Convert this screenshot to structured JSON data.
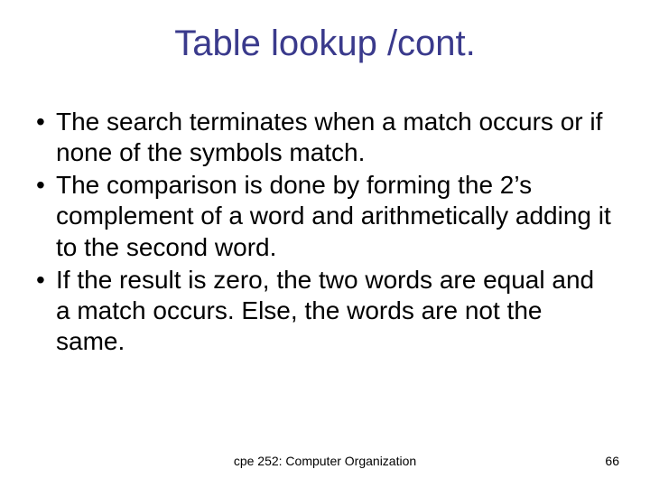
{
  "title": "Table lookup /cont.",
  "bullets": [
    "The search terminates when a match occurs or if none of the symbols match.",
    "The comparison is done by forming the 2’s complement of a word and arithmetically adding it to the second word.",
    "If the result is zero, the two words are equal and a match occurs. Else, the words are not the same."
  ],
  "footer": {
    "course": "cpe 252: Computer Organization",
    "page": "66"
  },
  "bullet_glyph": "•"
}
